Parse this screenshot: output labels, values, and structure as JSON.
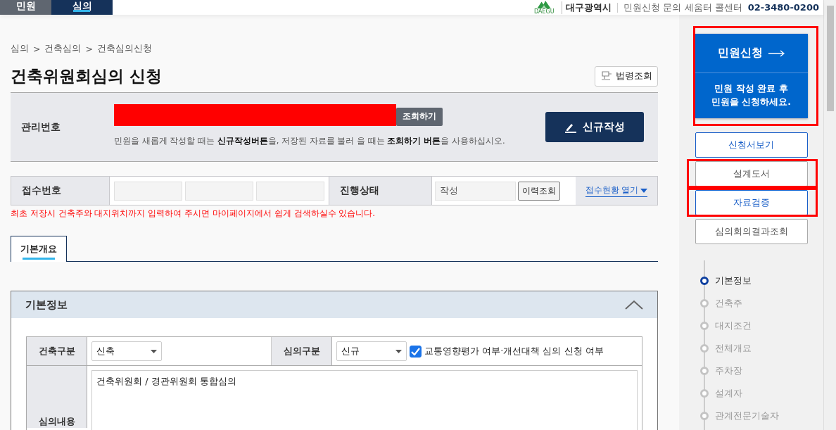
{
  "top_tabs": [
    {
      "label": "민원",
      "selected": false
    },
    {
      "label": "심의",
      "selected": true
    }
  ],
  "header": {
    "logo_text": "DAEGU",
    "city": "대구광역시",
    "inquiry": "민원신청 문의 세움터 콜센터",
    "phone": "02-3480-0200"
  },
  "breadcrumb": [
    "심의",
    "건축심의",
    "건축심의신청"
  ],
  "breadcrumb_separator": ">",
  "title": "건축위원회심의 신청",
  "law_button": "법령조회",
  "management": {
    "label": "관리번호",
    "redacted": true,
    "search_button": "조회하기",
    "hint": "민원을 새롭게 작성할 때는 **신규작성버튼**을, 저장된 자료를 불러 을 때는 **조회하기 버튼**을 사용하십시오.",
    "new_button": "신규작성"
  },
  "reception": {
    "label": "접수번호",
    "status_label": "진행상태",
    "status_value": "작성",
    "history_button": "이력조회",
    "toggle_link": "접수현황 열기"
  },
  "notice": "최초 저장시 건축주와 대지위치까지 입력하여 주시면 마이페이지에서 쉽게 검색하실수 있습니다.",
  "tabs": [
    {
      "label": "기본개요",
      "selected": true
    }
  ],
  "section": {
    "title": "기본정보",
    "expanded": true,
    "building_type": {
      "label": "건축구분",
      "value": "신축"
    },
    "review_type": {
      "label": "심의구분",
      "value": "신규"
    },
    "traffic": {
      "label": "교통영향평가 여부·개선대책 심의 신청 여부",
      "checked": true
    },
    "content": {
      "label": "심의내용",
      "value": "건축위원회 / 경관위원회 통합심의"
    }
  },
  "apply_box": {
    "title": "민원신청",
    "note": "민원 작성 완료 후\n민원을 신청하세요.",
    "highlighted": true
  },
  "side_buttons": [
    {
      "label": "신청서보기",
      "emphasized": true,
      "highlighted": false
    },
    {
      "label": "설계도서",
      "emphasized": false,
      "highlighted": true
    },
    {
      "label": "자료검증",
      "emphasized": true,
      "highlighted": true
    },
    {
      "label": "심의회의결과조회",
      "emphasized": false,
      "highlighted": false
    }
  ],
  "steps": [
    {
      "label": "기본정보",
      "selected": true
    },
    {
      "label": "건축주",
      "selected": false
    },
    {
      "label": "대지조건",
      "selected": false
    },
    {
      "label": "전체개요",
      "selected": false
    },
    {
      "label": "주차장",
      "selected": false
    },
    {
      "label": "설계자",
      "selected": false
    },
    {
      "label": "관계전문기술자",
      "selected": false
    }
  ]
}
